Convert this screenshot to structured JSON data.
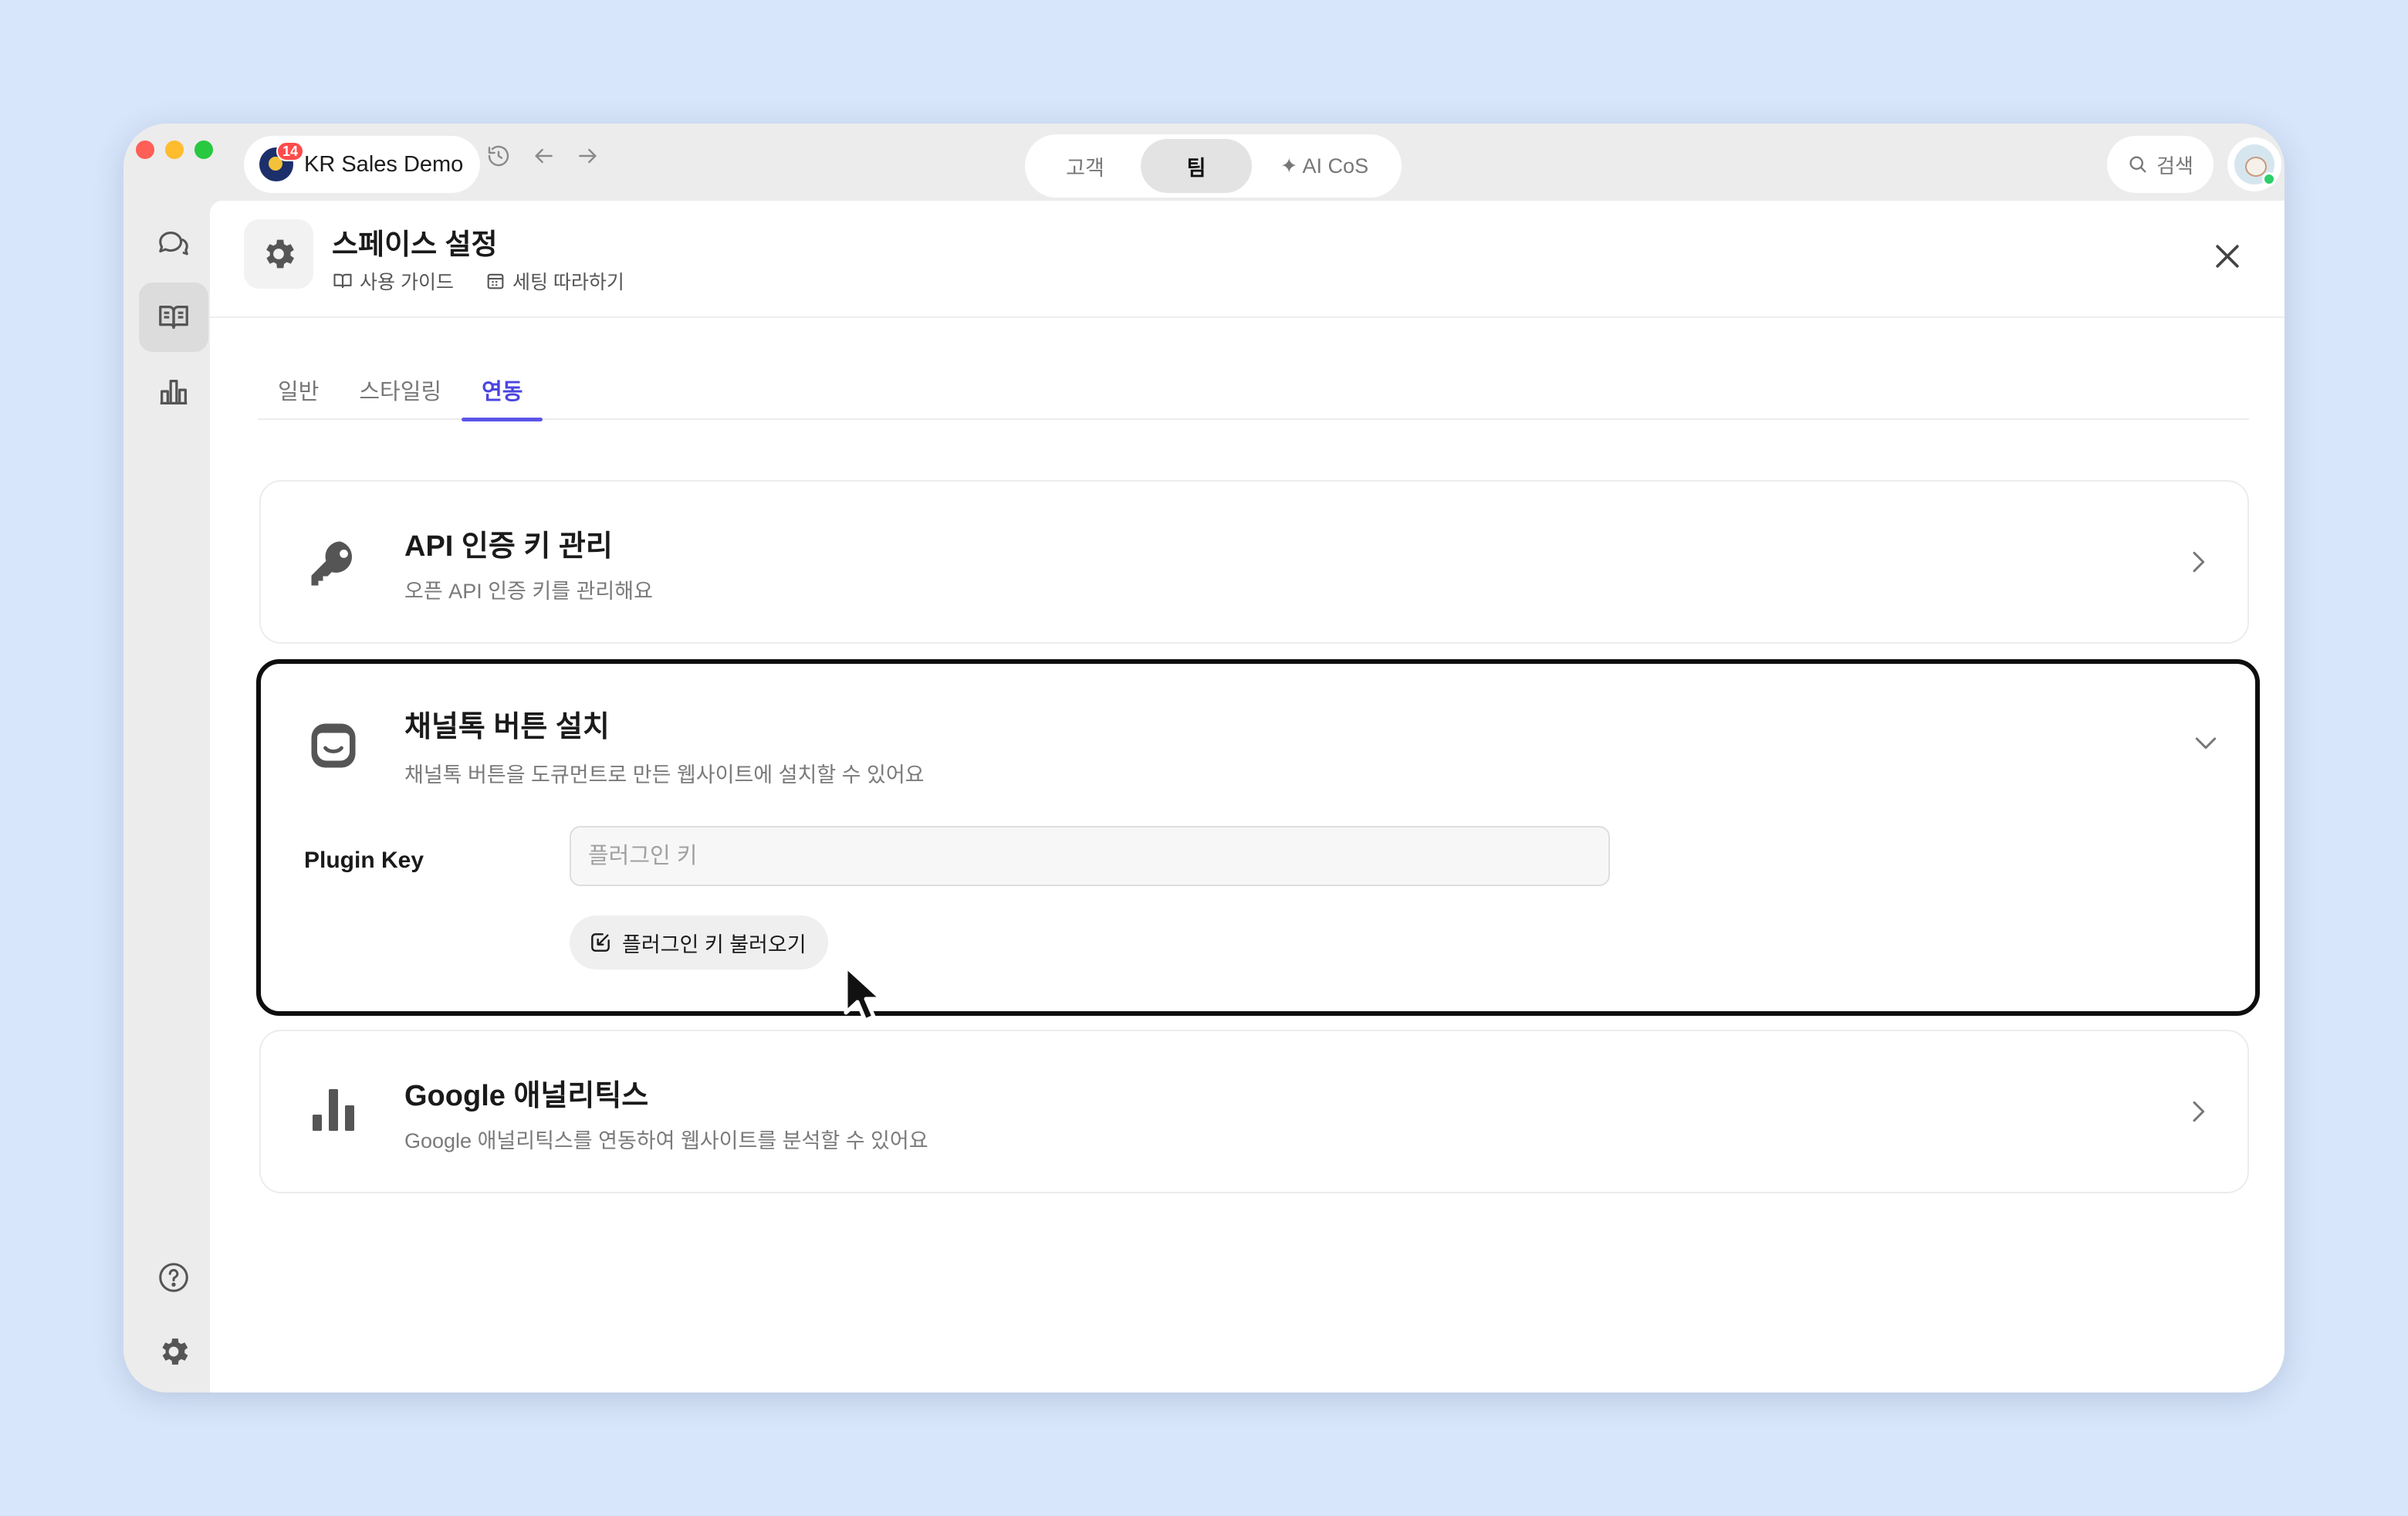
{
  "titlebar": {
    "workspace_name": "KR Sales Demo",
    "notification_count": "14",
    "segments": [
      "고객",
      "팀",
      "✦ AI CoS"
    ],
    "selected_segment": "팀",
    "search_label": "검색"
  },
  "header": {
    "title": "스페이스 설정",
    "links": [
      "사용 가이드",
      "세팅 따라하기"
    ]
  },
  "tabs": [
    "일반",
    "스타일링",
    "연동"
  ],
  "active_tab": "연동",
  "cards": {
    "api": {
      "title": "API 인증 키 관리",
      "description": "오픈 API 인증 키를 관리해요",
      "icon": "key-icon"
    },
    "channeltalk": {
      "title": "채널톡 버튼 설치",
      "description": "채널톡 버튼을 도큐먼트로 만든 웹사이트에 설치할 수 있어요",
      "icon": "channeltalk-icon",
      "plugin_key_label": "Plugin Key",
      "plugin_key_placeholder": "플러그인 키",
      "plugin_key_value": "",
      "load_button_label": "플러그인 키 불러오기"
    },
    "ga": {
      "title": "Google 애널리틱스",
      "description": "Google 애널리틱스를 연동하여 웹사이트를 분석할 수 있어요",
      "icon": "bar-chart-icon"
    }
  },
  "colors": {
    "background": "#d8e6fb",
    "accent": "#5b54e8",
    "badge": "#ff4b4b"
  }
}
